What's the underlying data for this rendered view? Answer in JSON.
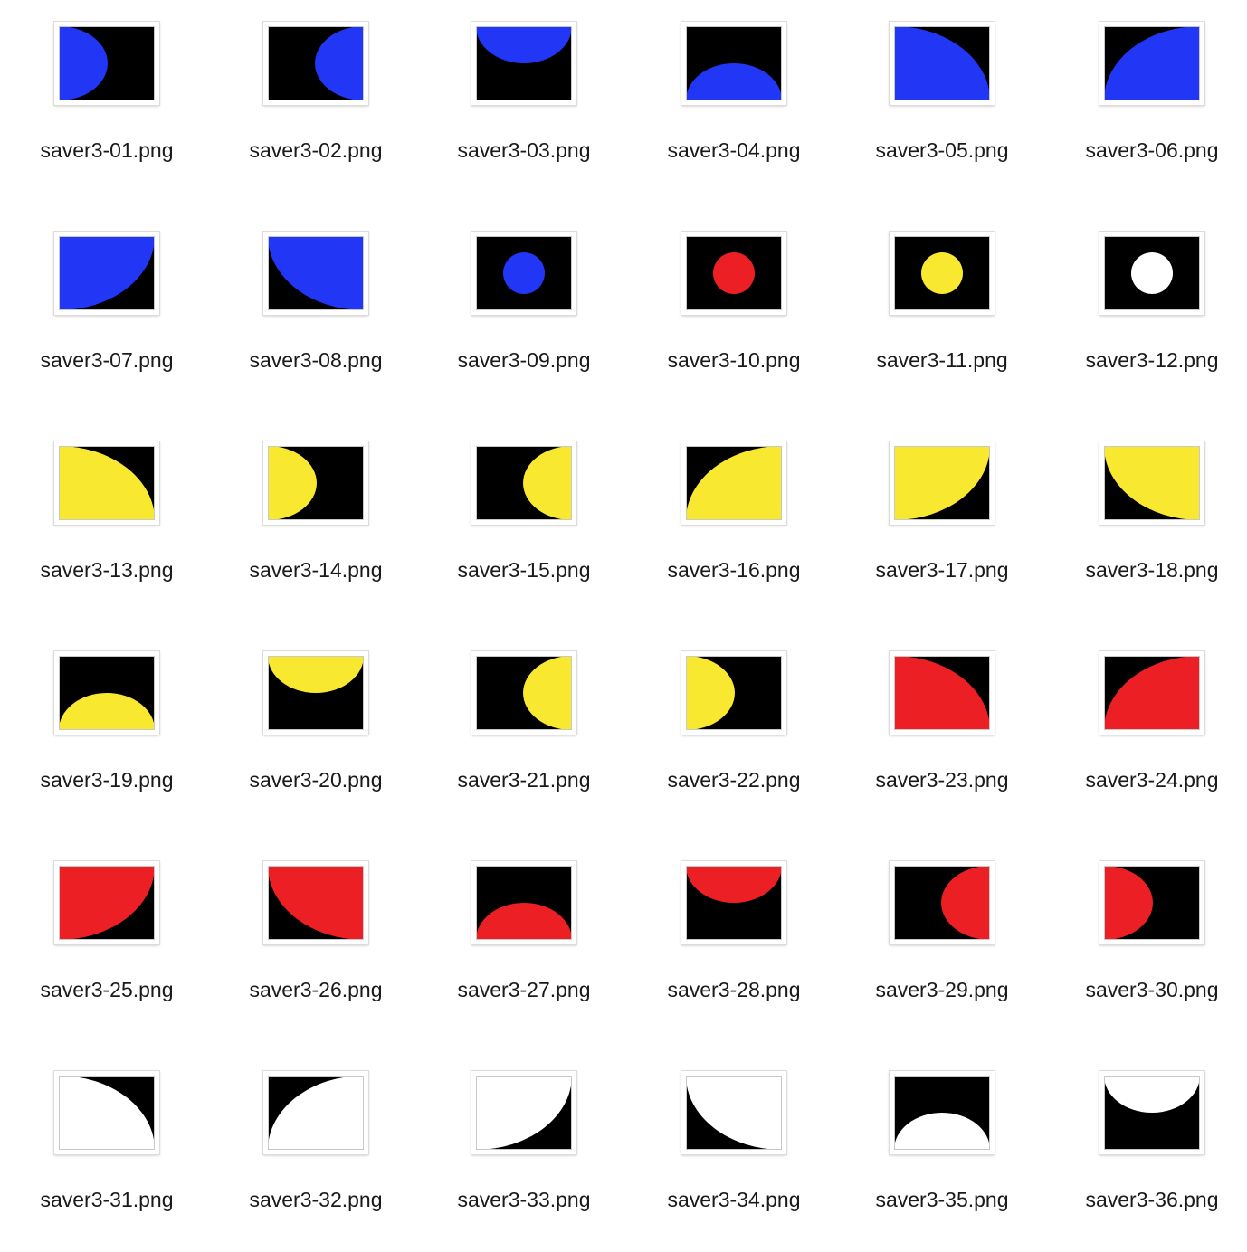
{
  "window": {
    "view": "icon-grid"
  },
  "colors": {
    "black": "#000000",
    "blue": "#2236f5",
    "red": "#ec2024",
    "yellow": "#f8e830",
    "white": "#ffffff"
  },
  "files": [
    {
      "name": "saver3-01.png",
      "fill": "blue",
      "shape": "half-ellipse-left"
    },
    {
      "name": "saver3-02.png",
      "fill": "blue",
      "shape": "half-ellipse-right"
    },
    {
      "name": "saver3-03.png",
      "fill": "blue",
      "shape": "half-ellipse-top"
    },
    {
      "name": "saver3-04.png",
      "fill": "blue",
      "shape": "half-ellipse-bottom"
    },
    {
      "name": "saver3-05.png",
      "fill": "blue",
      "shape": "quarter-top-left"
    },
    {
      "name": "saver3-06.png",
      "fill": "blue",
      "shape": "quarter-top-right"
    },
    {
      "name": "saver3-07.png",
      "fill": "blue",
      "shape": "quarter-bottom-left"
    },
    {
      "name": "saver3-08.png",
      "fill": "blue",
      "shape": "quarter-bottom-right"
    },
    {
      "name": "saver3-09.png",
      "fill": "blue",
      "shape": "center-circle"
    },
    {
      "name": "saver3-10.png",
      "fill": "red",
      "shape": "center-circle"
    },
    {
      "name": "saver3-11.png",
      "fill": "yellow",
      "shape": "center-circle"
    },
    {
      "name": "saver3-12.png",
      "fill": "white",
      "shape": "center-circle"
    },
    {
      "name": "saver3-13.png",
      "fill": "yellow",
      "shape": "quarter-top-left"
    },
    {
      "name": "saver3-14.png",
      "fill": "yellow",
      "shape": "half-ellipse-left"
    },
    {
      "name": "saver3-15.png",
      "fill": "yellow",
      "shape": "half-ellipse-right"
    },
    {
      "name": "saver3-16.png",
      "fill": "yellow",
      "shape": "quarter-top-right"
    },
    {
      "name": "saver3-17.png",
      "fill": "yellow",
      "shape": "quarter-bottom-left"
    },
    {
      "name": "saver3-18.png",
      "fill": "yellow",
      "shape": "quarter-bottom-right"
    },
    {
      "name": "saver3-19.png",
      "fill": "yellow",
      "shape": "half-ellipse-bottom"
    },
    {
      "name": "saver3-20.png",
      "fill": "yellow",
      "shape": "half-ellipse-top"
    },
    {
      "name": "saver3-21.png",
      "fill": "yellow",
      "shape": "half-ellipse-right"
    },
    {
      "name": "saver3-22.png",
      "fill": "yellow",
      "shape": "half-ellipse-left"
    },
    {
      "name": "saver3-23.png",
      "fill": "red",
      "shape": "quarter-top-left"
    },
    {
      "name": "saver3-24.png",
      "fill": "red",
      "shape": "quarter-top-right"
    },
    {
      "name": "saver3-25.png",
      "fill": "red",
      "shape": "quarter-bottom-left"
    },
    {
      "name": "saver3-26.png",
      "fill": "red",
      "shape": "quarter-bottom-right"
    },
    {
      "name": "saver3-27.png",
      "fill": "red",
      "shape": "half-ellipse-bottom"
    },
    {
      "name": "saver3-28.png",
      "fill": "red",
      "shape": "half-ellipse-top"
    },
    {
      "name": "saver3-29.png",
      "fill": "red",
      "shape": "half-ellipse-right"
    },
    {
      "name": "saver3-30.png",
      "fill": "red",
      "shape": "half-ellipse-left"
    },
    {
      "name": "saver3-31.png",
      "fill": "white",
      "shape": "quarter-top-left"
    },
    {
      "name": "saver3-32.png",
      "fill": "white",
      "shape": "quarter-top-right"
    },
    {
      "name": "saver3-33.png",
      "fill": "white",
      "shape": "quarter-bottom-left"
    },
    {
      "name": "saver3-34.png",
      "fill": "white",
      "shape": "quarter-bottom-right"
    },
    {
      "name": "saver3-35.png",
      "fill": "white",
      "shape": "half-ellipse-bottom"
    },
    {
      "name": "saver3-36.png",
      "fill": "white",
      "shape": "half-ellipse-top"
    }
  ]
}
